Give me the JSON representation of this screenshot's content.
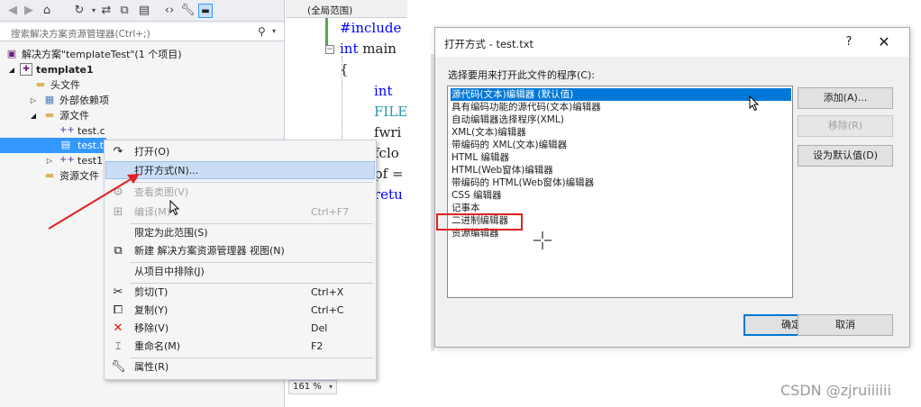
{
  "solution_explorer": {
    "search_placeholder": "搜索解决方案资源管理器(Ctrl+;)",
    "tree": [
      {
        "label": "解决方案\"templateTest\"(1 个项目)",
        "icon": "solution-icon"
      },
      {
        "label": "template1",
        "icon": "project-icon",
        "bold": true
      },
      {
        "label": "头文件",
        "icon": "folder-icon"
      },
      {
        "label": "外部依赖项",
        "icon": "external-deps-icon"
      },
      {
        "label": "源文件",
        "icon": "folder-icon"
      },
      {
        "label": "test.c",
        "icon": "cpp-file-icon"
      },
      {
        "label": "test.t",
        "icon": "text-file-icon",
        "selected": true
      },
      {
        "label": "test1",
        "icon": "cpp-file-icon"
      },
      {
        "label": "资源文件",
        "icon": "folder-icon"
      }
    ]
  },
  "editor": {
    "scope": "(全局范围)",
    "lines": [
      "#include",
      "int main",
      "{",
      "int",
      "FILE",
      "fwri",
      "fclo",
      "pf =",
      "retu"
    ],
    "zoom": "161 %"
  },
  "context_menu": {
    "items": [
      {
        "label": "打开(O)",
        "shortcut": "",
        "icon": "open-icon",
        "disabled": false
      },
      {
        "label": "打开方式(N)...",
        "shortcut": "",
        "icon": "",
        "disabled": false,
        "hover": true
      },
      {
        "label": "查看类图(V)",
        "shortcut": "",
        "icon": "class-diagram-icon",
        "disabled": true
      },
      {
        "label": "编译(M)",
        "shortcut": "Ctrl+F7",
        "icon": "compile-icon",
        "disabled": true
      },
      {
        "label": "限定为此范围(S)",
        "shortcut": "",
        "icon": "",
        "disabled": false
      },
      {
        "label": "新建 解决方案资源管理器 视图(N)",
        "shortcut": "",
        "icon": "new-view-icon",
        "disabled": false
      },
      {
        "label": "从项目中排除(J)",
        "shortcut": "",
        "icon": "",
        "disabled": false
      },
      {
        "label": "剪切(T)",
        "shortcut": "Ctrl+X",
        "icon": "cut-icon",
        "disabled": false
      },
      {
        "label": "复制(Y)",
        "shortcut": "Ctrl+C",
        "icon": "copy-icon",
        "disabled": false
      },
      {
        "label": "移除(V)",
        "shortcut": "Del",
        "icon": "remove-icon",
        "disabled": false
      },
      {
        "label": "重命名(M)",
        "shortcut": "F2",
        "icon": "rename-icon",
        "disabled": false
      },
      {
        "label": "属性(R)",
        "shortcut": "",
        "icon": "properties-icon",
        "disabled": false
      }
    ]
  },
  "dialog": {
    "title": "打开方式 - test.txt",
    "help": "?",
    "close": "✕",
    "prompt": "选择要用来打开此文件的程序(C):",
    "programs": [
      "源代码(文本)编辑器 (默认值)",
      "具有编码功能的源代码(文本)编辑器",
      "自动编辑器选择程序(XML)",
      "XML(文本)编辑器",
      "带编码的 XML(文本)编辑器",
      "HTML 编辑器",
      "HTML(Web窗体)编辑器",
      "带编码的 HTML(Web窗体)编辑器",
      "CSS 编辑器",
      "记事本",
      "二进制编辑器",
      "资源编辑器"
    ],
    "buttons": {
      "add": "添加(A)...",
      "remove": "移除(R)",
      "set_default": "设为默认值(D)",
      "ok": "确定",
      "cancel": "取消"
    }
  },
  "watermark": "CSDN @zjruiiiiii",
  "colors": {
    "selection_blue": "#3399ff",
    "dialog_selection": "#0078d7",
    "annotation_red": "#e02020",
    "keyword_blue": "#0000ff"
  }
}
